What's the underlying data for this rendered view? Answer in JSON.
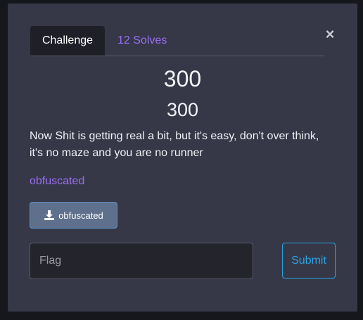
{
  "tabs": {
    "challenge_label": "Challenge",
    "solves_label": "12 Solves"
  },
  "close_symbol": "×",
  "challenge": {
    "name": "300",
    "value": "300",
    "description": "Now Shit is getting real a bit, but it's easy, don't over think, it's no maze and you are no runner",
    "file_link_text": "obfuscated",
    "download_button_label": "obfuscated"
  },
  "flag_form": {
    "placeholder": "Flag",
    "value": "",
    "submit_label": "Submit"
  },
  "colors": {
    "accent_link": "#9b6ef0",
    "submit_outline": "#29a5e3",
    "modal_bg": "#363848"
  },
  "icons": {
    "close": "close-icon",
    "download": "download-icon"
  }
}
